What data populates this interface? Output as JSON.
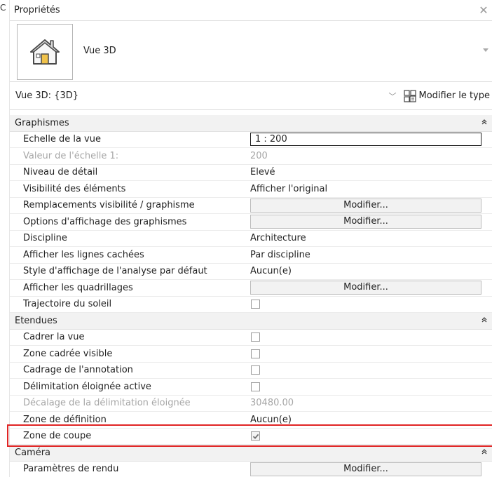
{
  "stray_char": "C",
  "panel": {
    "title": "Propriétés"
  },
  "type_selector": {
    "family_label": "Vue 3D"
  },
  "instance_selector": {
    "value": "Vue 3D: {3D}",
    "modify_type_label": "Modifier le type"
  },
  "sections": [
    {
      "title": "Graphismes",
      "rows": [
        {
          "name": "Echelle de la vue",
          "value": "1 : 200",
          "kind": "input"
        },
        {
          "name": "Valeur de l'échelle    1:",
          "value": "200",
          "kind": "text",
          "disabled": true
        },
        {
          "name": "Niveau de détail",
          "value": "Elevé",
          "kind": "text"
        },
        {
          "name": "Visibilité des éléments",
          "value": "Afficher l'original",
          "kind": "text"
        },
        {
          "name": "Remplacements visibilité / graphisme",
          "value": "Modifier...",
          "kind": "button"
        },
        {
          "name": "Options d'affichage des graphismes",
          "value": "Modifier...",
          "kind": "button"
        },
        {
          "name": "Discipline",
          "value": "Architecture",
          "kind": "text"
        },
        {
          "name": "Afficher les lignes cachées",
          "value": "Par discipline",
          "kind": "text"
        },
        {
          "name": "Style d'affichage de l'analyse par défaut",
          "value": "Aucun(e)",
          "kind": "text"
        },
        {
          "name": "Afficher les quadrillages",
          "value": "Modifier...",
          "kind": "button"
        },
        {
          "name": "Trajectoire du soleil",
          "value": false,
          "kind": "checkbox"
        }
      ]
    },
    {
      "title": "Etendues",
      "rows": [
        {
          "name": "Cadrer la vue",
          "value": false,
          "kind": "checkbox"
        },
        {
          "name": "Zone cadrée visible",
          "value": false,
          "kind": "checkbox"
        },
        {
          "name": "Cadrage de l'annotation",
          "value": false,
          "kind": "checkbox"
        },
        {
          "name": "Délimitation éloignée active",
          "value": false,
          "kind": "checkbox"
        },
        {
          "name": "Décalage de la délimitation éloignée",
          "value": "30480.00",
          "kind": "text",
          "disabled": true
        },
        {
          "name": "Zone de définition",
          "value": "Aucun(e)",
          "kind": "text"
        },
        {
          "name": "Zone de coupe",
          "value": true,
          "kind": "checkbox",
          "checked_disabled": true
        }
      ]
    },
    {
      "title": "Caméra",
      "rows": [
        {
          "name": "Paramètres de rendu",
          "value": "Modifier...",
          "kind": "button"
        }
      ]
    }
  ],
  "colors": {
    "highlight": "#e02424",
    "header_bg": "#f2f2f2",
    "button_bg": "#f2f2f2"
  },
  "icons": {
    "close": "close-icon",
    "view_thumbnail": "house-3d-view-icon",
    "dropdown": "chevron-down-icon",
    "modify_type": "edit-type-icon",
    "collapse": "collapse-chevron-icon",
    "checkmark": "checkmark-icon"
  }
}
